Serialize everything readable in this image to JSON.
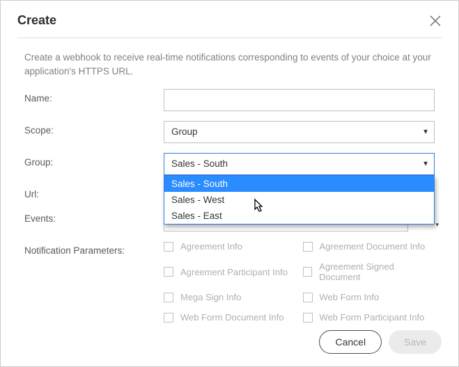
{
  "header": {
    "title": "Create"
  },
  "description": "Create a webhook to receive real-time notifications corresponding to events of your choice at your application's HTTPS URL.",
  "fields": {
    "name_label": "Name:",
    "name_value": "",
    "scope_label": "Scope:",
    "scope_value": "Group",
    "group_label": "Group:",
    "group_value": "Sales - South",
    "group_options": {
      "0": "Sales - South",
      "1": "Sales - West",
      "2": "Sales - East"
    },
    "url_label": "Url:",
    "url_value": "",
    "events_label": "Events:",
    "params_label": "Notification Parameters:"
  },
  "params": {
    "0": "Agreement Info",
    "1": "Agreement Document Info",
    "2": "Agreement Participant Info",
    "3": "Agreement Signed Document",
    "4": "Mega Sign Info",
    "5": "Web Form Info",
    "6": "Web Form Document Info",
    "7": "Web Form Participant Info"
  },
  "footer": {
    "cancel": "Cancel",
    "save": "Save"
  }
}
